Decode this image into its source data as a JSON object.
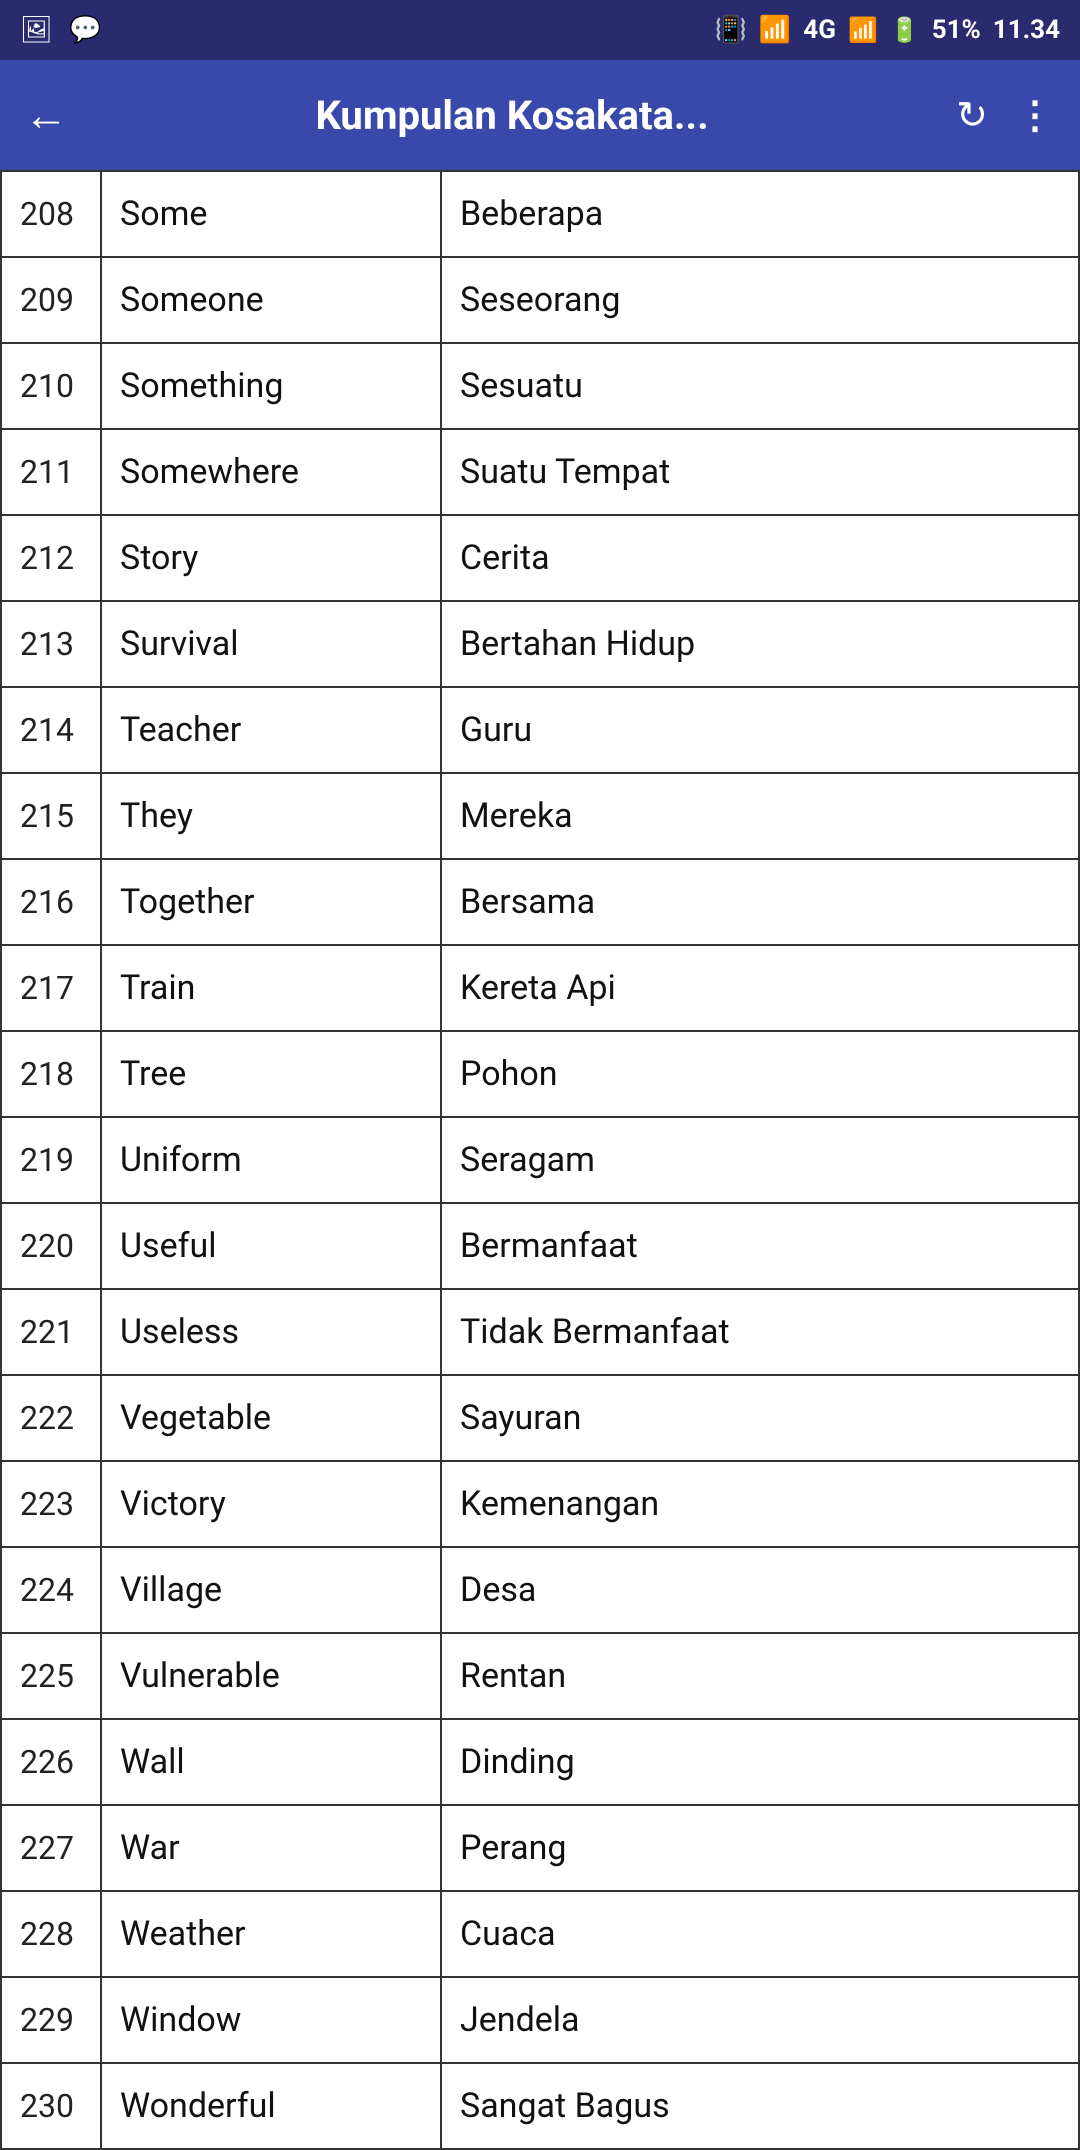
{
  "statusBar": {
    "battery": "51%",
    "time": "11.34",
    "signal": "4G"
  },
  "appBar": {
    "title": "Kumpulan Kosakata...",
    "backLabel": "←",
    "refreshLabel": "↻",
    "menuLabel": "⋮"
  },
  "vocab": [
    {
      "num": "208",
      "english": "Some",
      "indonesian": "Beberapa"
    },
    {
      "num": "209",
      "english": "Someone",
      "indonesian": "Seseorang"
    },
    {
      "num": "210",
      "english": "Something",
      "indonesian": "Sesuatu"
    },
    {
      "num": "211",
      "english": "Somewhere",
      "indonesian": "Suatu Tempat"
    },
    {
      "num": "212",
      "english": "Story",
      "indonesian": "Cerita"
    },
    {
      "num": "213",
      "english": "Survival",
      "indonesian": "Bertahan Hidup"
    },
    {
      "num": "214",
      "english": "Teacher",
      "indonesian": "Guru"
    },
    {
      "num": "215",
      "english": "They",
      "indonesian": "Mereka"
    },
    {
      "num": "216",
      "english": "Together",
      "indonesian": "Bersama"
    },
    {
      "num": "217",
      "english": "Train",
      "indonesian": "Kereta Api"
    },
    {
      "num": "218",
      "english": "Tree",
      "indonesian": "Pohon"
    },
    {
      "num": "219",
      "english": "Uniform",
      "indonesian": "Seragam"
    },
    {
      "num": "220",
      "english": "Useful",
      "indonesian": "Bermanfaat"
    },
    {
      "num": "221",
      "english": "Useless",
      "indonesian": "Tidak Bermanfaat"
    },
    {
      "num": "222",
      "english": "Vegetable",
      "indonesian": "Sayuran"
    },
    {
      "num": "223",
      "english": "Victory",
      "indonesian": "Kemenangan"
    },
    {
      "num": "224",
      "english": "Village",
      "indonesian": "Desa"
    },
    {
      "num": "225",
      "english": "Vulnerable",
      "indonesian": "Rentan"
    },
    {
      "num": "226",
      "english": "Wall",
      "indonesian": "Dinding"
    },
    {
      "num": "227",
      "english": "War",
      "indonesian": "Perang"
    },
    {
      "num": "228",
      "english": "Weather",
      "indonesian": "Cuaca"
    },
    {
      "num": "229",
      "english": "Window",
      "indonesian": "Jendela"
    },
    {
      "num": "230",
      "english": "Wonderful",
      "indonesian": "Sangat Bagus"
    }
  ]
}
